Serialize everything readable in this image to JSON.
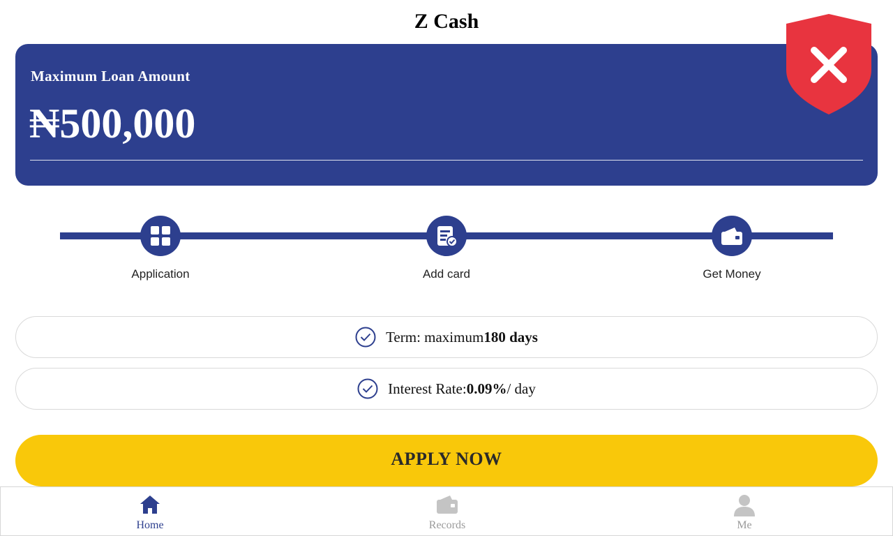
{
  "header": {
    "title": "Z Cash"
  },
  "loan_card": {
    "label": "Maximum Loan Amount",
    "amount": "₦500,000"
  },
  "steps": [
    {
      "label": "Application",
      "icon": "grid-icon"
    },
    {
      "label": "Add card",
      "icon": "document-check-icon"
    },
    {
      "label": "Get Money",
      "icon": "wallet-icon"
    }
  ],
  "info": {
    "term_prefix": "Term: maximum",
    "term_value": "180 days",
    "rate_prefix": "Interest Rate:",
    "rate_value": "0.09%",
    "rate_suffix": "/ day"
  },
  "apply_button": {
    "label": "APPLY NOW"
  },
  "bottom_nav": [
    {
      "label": "Home",
      "icon": "home-icon",
      "active": true
    },
    {
      "label": "Records",
      "icon": "wallet-icon",
      "active": false
    },
    {
      "label": "Me",
      "icon": "user-icon",
      "active": false
    }
  ],
  "colors": {
    "primary": "#2d3f8e",
    "accent": "#f9c80a",
    "badge": "#e8343f",
    "inactive": "#c4c4c4"
  }
}
